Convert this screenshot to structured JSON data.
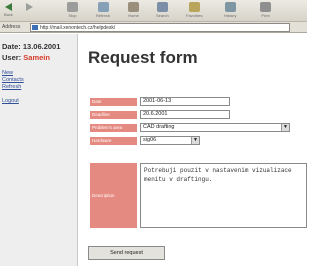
{
  "toolbar": {
    "back": "Back",
    "stop": "Stop",
    "refresh": "Refresh",
    "home": "Home",
    "search": "Search",
    "favorites": "Favorites",
    "history": "History",
    "print": "Print"
  },
  "address": {
    "label": "Address",
    "url": "http://mail.xenontech.cz/helpdesk/"
  },
  "sidebar": {
    "date_label": "Date:",
    "date_value": "13.06.2001",
    "user_label": "User:",
    "user_name": "Samein",
    "links": [
      "New",
      "Contacts",
      "Refresh",
      "Logout"
    ]
  },
  "main": {
    "title": "Request form",
    "fields": {
      "date": {
        "label": "Date",
        "value": "2001-06-13"
      },
      "deadline": {
        "label": "Deadline",
        "value": "20.6.2001"
      },
      "problem_area": {
        "label": "Problem's area",
        "value": "CAD drafting"
      },
      "hardware": {
        "label": "Hardware",
        "value": "sig06"
      },
      "description": {
        "label": "Description",
        "value": "Potrebuji pouzit v nastavenim vizualizace menitu v draftingu."
      }
    },
    "submit_label": "Send request"
  }
}
